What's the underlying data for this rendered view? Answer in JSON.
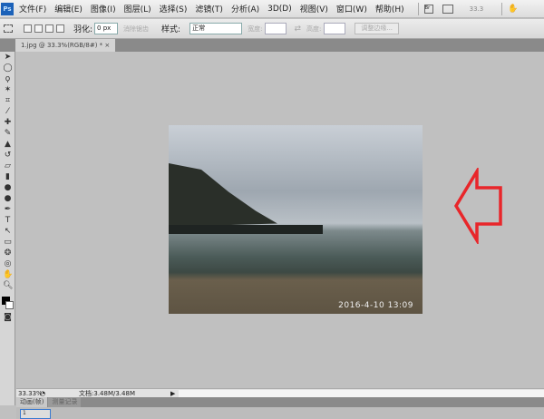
{
  "menubar": {
    "logo": "Ps",
    "items": [
      "文件(F)",
      "编辑(E)",
      "图像(I)",
      "图层(L)",
      "选择(S)",
      "滤镜(T)",
      "分析(A)",
      "3D(D)",
      "视图(V)",
      "窗口(W)",
      "帮助(H)"
    ],
    "zoom": "33.3"
  },
  "options": {
    "feather_label": "羽化:",
    "feather_value": "0 px",
    "antialias": "消除锯齿",
    "style_label": "样式:",
    "style_value": "正常",
    "width_label": "宽度:",
    "height_label": "高度:",
    "refine_edge": "调整边缘..."
  },
  "document": {
    "tab": "1.jpg @ 33.3%(RGB/8#) *",
    "close": "×",
    "photo_timestamp": "2016-4-10 13:09"
  },
  "status": {
    "zoom": "33.33%",
    "doc_size": "文档:3.48M/3.48M"
  },
  "panels": {
    "tabs": [
      "动画(帧)",
      "测量记录"
    ],
    "frame_number": "1"
  },
  "colors": {
    "arrow": "#e8262a",
    "accent": "#1c62b9"
  }
}
